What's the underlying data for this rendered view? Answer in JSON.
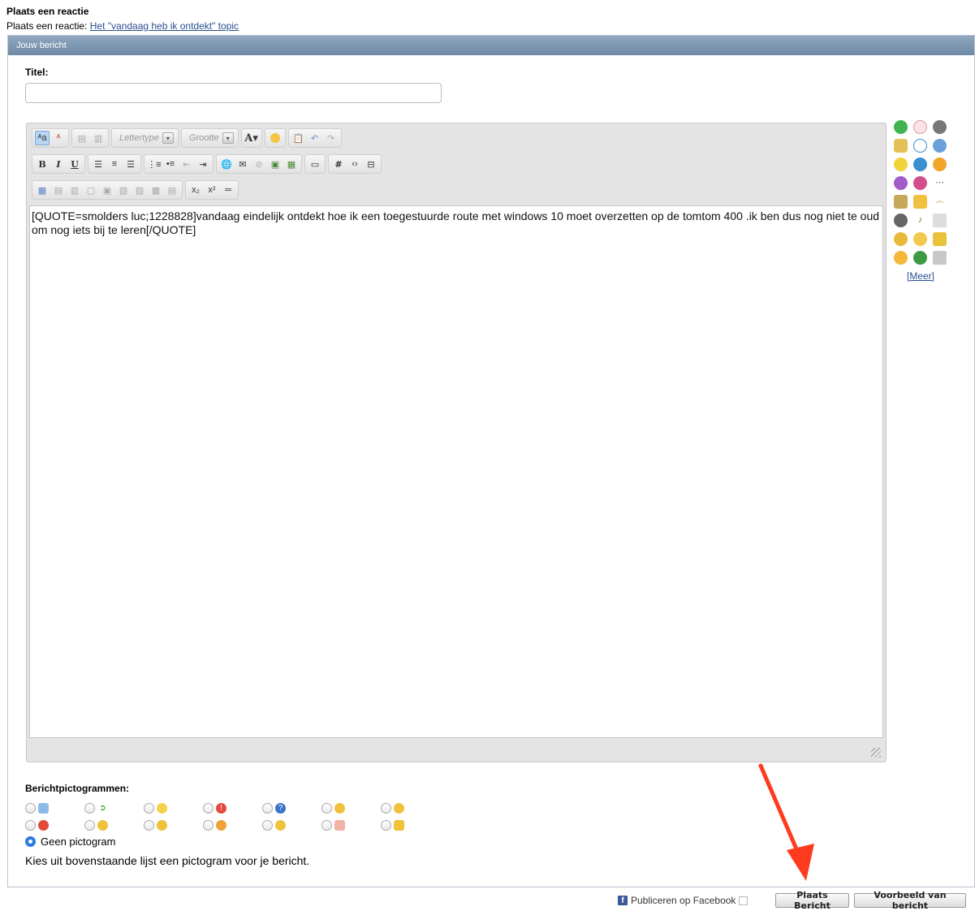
{
  "header": {
    "title": "Plaats een reactie",
    "sub_prefix": "Plaats een reactie: ",
    "topic_link": "Het \"vandaag heb ik ontdekt\" topic"
  },
  "panel": {
    "bar_title": "Jouw bericht"
  },
  "form": {
    "title_label": "Titel:",
    "title_value": ""
  },
  "editor": {
    "font_combo": "Lettertype",
    "size_combo": "Grootte",
    "content": "[QUOTE=smolders luc;1228828]vandaag eindelijk ontdekt hoe ik een toegestuurde route met windows 10 moet overzetten op de tomtom 400 .ik ben dus nog niet te oud om nog iets bij te leren[/QUOTE]"
  },
  "smilies": {
    "more_label": "[Meer]"
  },
  "post_icons": {
    "label": "Berichtpictogrammen:",
    "none_label": "Geen pictogram",
    "help": "Kies uit bovenstaande lijst een pictogram voor je bericht."
  },
  "footer": {
    "facebook_label": "Publiceren op Facebook",
    "submit_label": "Plaats Bericht",
    "preview_label": "Voorbeeld van bericht"
  },
  "colors": {
    "accent": "#2f7be0",
    "panel_bar": "#7f99b4",
    "link": "#2a4f8d",
    "arrow": "#ff3b1f"
  }
}
